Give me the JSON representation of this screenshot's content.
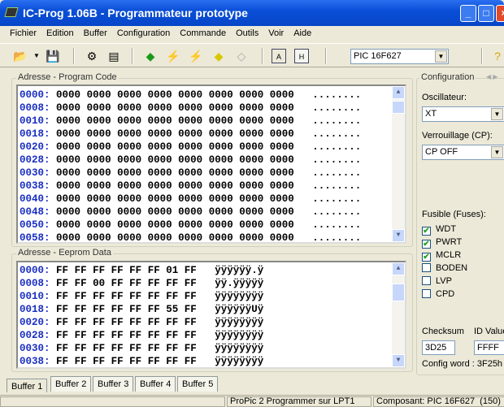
{
  "window": {
    "title": "IC-Prog 1.06B - Programmateur prototype"
  },
  "menu": [
    "Fichier",
    "Edition",
    "Buffer",
    "Configuration",
    "Commande",
    "Outils",
    "Voir",
    "Aide"
  ],
  "toolbar": {
    "device": "PIC 16F627"
  },
  "program": {
    "label": "Adresse - Program Code",
    "addresses": [
      "0000:",
      "0008:",
      "0010:",
      "0018:",
      "0020:",
      "0028:",
      "0030:",
      "0038:",
      "0040:",
      "0048:",
      "0050:",
      "0058:"
    ],
    "word": "0000",
    "ascii": "........"
  },
  "eeprom": {
    "label": "Adresse - Eeprom Data",
    "rows": [
      {
        "addr": "0000:",
        "bytes": [
          "FF",
          "FF",
          "FF",
          "FF",
          "FF",
          "FF",
          "01",
          "FF"
        ],
        "ascii": "ÿÿÿÿÿÿ.ÿ"
      },
      {
        "addr": "0008:",
        "bytes": [
          "FF",
          "FF",
          "00",
          "FF",
          "FF",
          "FF",
          "FF",
          "FF"
        ],
        "ascii": "ÿÿ.ÿÿÿÿÿ"
      },
      {
        "addr": "0010:",
        "bytes": [
          "FF",
          "FF",
          "FF",
          "FF",
          "FF",
          "FF",
          "FF",
          "FF"
        ],
        "ascii": "ÿÿÿÿÿÿÿÿ"
      },
      {
        "addr": "0018:",
        "bytes": [
          "FF",
          "FF",
          "FF",
          "FF",
          "FF",
          "FF",
          "55",
          "FF"
        ],
        "ascii": "ÿÿÿÿÿÿUÿ"
      },
      {
        "addr": "0020:",
        "bytes": [
          "FF",
          "FF",
          "FF",
          "FF",
          "FF",
          "FF",
          "FF",
          "FF"
        ],
        "ascii": "ÿÿÿÿÿÿÿÿ"
      },
      {
        "addr": "0028:",
        "bytes": [
          "FF",
          "FF",
          "FF",
          "FF",
          "FF",
          "FF",
          "FF",
          "FF"
        ],
        "ascii": "ÿÿÿÿÿÿÿÿ"
      },
      {
        "addr": "0030:",
        "bytes": [
          "FF",
          "FF",
          "FF",
          "FF",
          "FF",
          "FF",
          "FF",
          "FF"
        ],
        "ascii": "ÿÿÿÿÿÿÿÿ"
      },
      {
        "addr": "0038:",
        "bytes": [
          "FF",
          "FF",
          "FF",
          "FF",
          "FF",
          "FF",
          "FF",
          "FF"
        ],
        "ascii": "ÿÿÿÿÿÿÿÿ"
      }
    ]
  },
  "tabs": [
    "Buffer 1",
    "Buffer 2",
    "Buffer 3",
    "Buffer 4",
    "Buffer 5"
  ],
  "config": {
    "title": "Configuration",
    "osc_label": "Oscillateur:",
    "osc_value": "XT",
    "cp_label": "Verrouillage (CP):",
    "cp_value": "CP OFF",
    "fuses_label": "Fusible (Fuses):",
    "fuses": [
      {
        "name": "WDT",
        "checked": true
      },
      {
        "name": "PWRT",
        "checked": true
      },
      {
        "name": "MCLR",
        "checked": true
      },
      {
        "name": "BODEN",
        "checked": false
      },
      {
        "name": "LVP",
        "checked": false
      },
      {
        "name": "CPD",
        "checked": false
      }
    ],
    "checksum_label": "Checksum",
    "checksum": "3D25",
    "id_label": "ID Value",
    "id_value": "FFFF",
    "config_word": "Config word : 3F25h"
  },
  "status": {
    "programmer": "ProPic 2 Programmer sur LPT1",
    "device": "Composant: PIC 16F627  (150)"
  }
}
